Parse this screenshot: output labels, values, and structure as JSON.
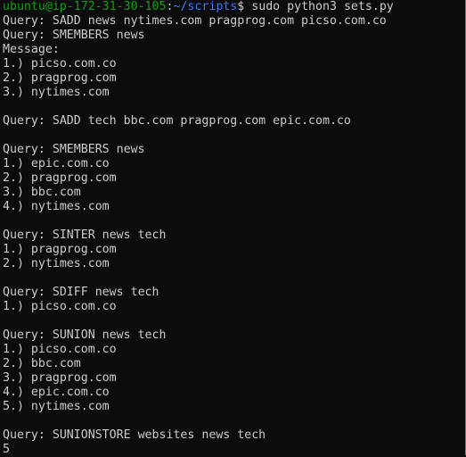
{
  "terminal": {
    "prompt": {
      "user_host": "ubuntu@ip-172-31-30-105",
      "separator": ":",
      "path": "~/scripts",
      "dollar": "$ ",
      "command": "sudo python3 sets.py"
    },
    "lines": [
      "Query: SADD news nytimes.com pragprog.com picso.com.co",
      "Query: SMEMBERS news",
      "Message:",
      "1.) picso.com.co",
      "2.) pragprog.com",
      "3.) nytimes.com",
      "",
      "Query: SADD tech bbc.com pragprog.com epic.com.co",
      "",
      "Query: SMEMBERS news",
      "1.) epic.com.co",
      "2.) pragprog.com",
      "3.) bbc.com",
      "4.) nytimes.com",
      "",
      "Query: SINTER news tech",
      "1.) pragprog.com",
      "2.) nytimes.com",
      "",
      "Query: SDIFF news tech",
      "1.) picso.com.co",
      "",
      "Query: SUNION news tech",
      "1.) picso.com.co",
      "2.) bbc.com",
      "3.) pragprog.com",
      "4.) epic.com.co",
      "5.) nytimes.com",
      "",
      "Query: SUNIONSTORE websites news tech",
      "5"
    ],
    "colors": {
      "background": "#0c0c0c",
      "text": "#cccccc",
      "prompt_user": "#13a10e",
      "prompt_path": "#3b78ff"
    }
  }
}
